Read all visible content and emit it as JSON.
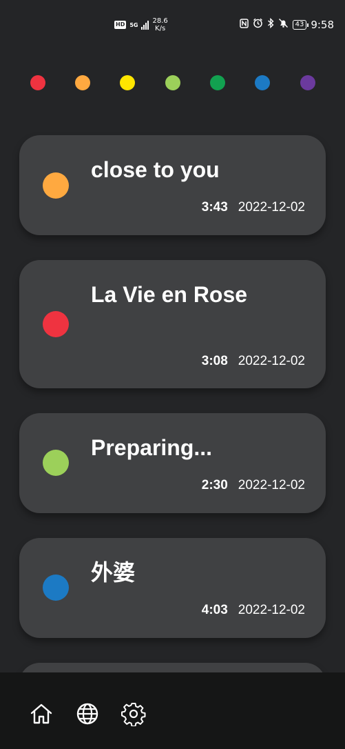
{
  "status_bar": {
    "hd": "HD",
    "network": "5G",
    "speed_value": "28.6",
    "speed_unit": "K/s",
    "battery": "43",
    "time": "9:58"
  },
  "color_filters": [
    {
      "name": "red",
      "color": "#ef3340"
    },
    {
      "name": "orange",
      "color": "#ffa940"
    },
    {
      "name": "yellow",
      "color": "#ffe600"
    },
    {
      "name": "light-green",
      "color": "#9cd05a"
    },
    {
      "name": "green",
      "color": "#12a150"
    },
    {
      "name": "blue",
      "color": "#1c7ac4"
    },
    {
      "name": "purple",
      "color": "#6b3a9e"
    }
  ],
  "recordings": [
    {
      "title": "close to you",
      "duration": "3:43",
      "date": "2022-12-02",
      "color": "#ffa940"
    },
    {
      "title": "La Vie en Rose",
      "duration": "3:08",
      "date": "2022-12-02",
      "color": "#ef3340"
    },
    {
      "title": "Preparing...",
      "duration": "2:30",
      "date": "2022-12-02",
      "color": "#9cd05a"
    },
    {
      "title": "外婆",
      "duration": "4:03",
      "date": "2022-12-02",
      "color": "#1c7ac4"
    }
  ],
  "nav": [
    {
      "name": "home-icon"
    },
    {
      "name": "globe-icon"
    },
    {
      "name": "settings-icon"
    }
  ]
}
